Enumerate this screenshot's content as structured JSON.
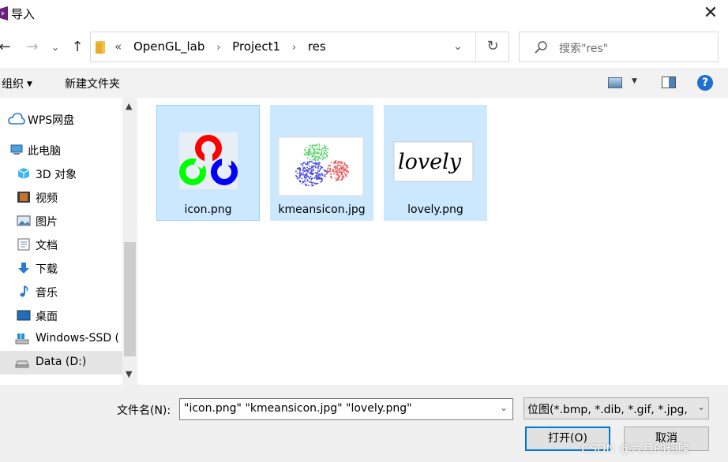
{
  "window": {
    "title": "导入",
    "close_glyph": "✕"
  },
  "nav": {
    "back": "←",
    "forward": "→",
    "recent": "⌄",
    "up": "↑"
  },
  "address": {
    "overflow": "«",
    "crumbs": [
      "OpenGL_lab",
      "Project1",
      "res"
    ],
    "separator": "›",
    "dropdown": "⌄",
    "refresh": "↻"
  },
  "search": {
    "placeholder": "搜索\"res\""
  },
  "toolbar": {
    "organize": "组织",
    "organize_arrow": "▼",
    "new_folder": "新建文件夹",
    "view_arrow": "▼",
    "help": "?"
  },
  "sidebar": {
    "items": [
      {
        "label": "WPS网盘",
        "icon": "cloud-icon"
      },
      {
        "label": "此电脑",
        "icon": "computer-icon"
      },
      {
        "label": "3D 对象",
        "icon": "cube-icon"
      },
      {
        "label": "视频",
        "icon": "video-icon"
      },
      {
        "label": "图片",
        "icon": "picture-icon"
      },
      {
        "label": "文档",
        "icon": "document-icon"
      },
      {
        "label": "下载",
        "icon": "download-icon"
      },
      {
        "label": "音乐",
        "icon": "music-icon"
      },
      {
        "label": "桌面",
        "icon": "desktop-icon"
      },
      {
        "label": "Windows-SSD (",
        "icon": "drive-icon"
      },
      {
        "label": "Data (D:)",
        "icon": "drive-icon"
      }
    ],
    "selected": "Data (D:)",
    "scroll_up": "▲",
    "scroll_down": "▼"
  },
  "files": [
    {
      "name": "icon.png",
      "selected": true,
      "thumbnail_text": ""
    },
    {
      "name": "kmeansicon.jpg",
      "selected": true,
      "thumbnail_text": ""
    },
    {
      "name": "lovely.png",
      "selected": true,
      "thumbnail_text": "lovely"
    }
  ],
  "footer": {
    "filename_label": "文件名(N):",
    "filename_value": "\"icon.png\" \"kmeansicon.jpg\" \"lovely.png\"",
    "filename_dropdown": "⌄",
    "filter_value": "位图(*.bmp, *.dib, *.gif, *.jpg,",
    "filter_dropdown": "⌄",
    "open_button": "打开(O)",
    "cancel_button": "取消"
  },
  "watermark": "CSDN @六月的翅膀",
  "colors": {
    "accent": "#0078d7",
    "selection_fill": "#cce8ff",
    "selection_border": "#99d1ff",
    "help_blue": "#1f6fd1"
  }
}
